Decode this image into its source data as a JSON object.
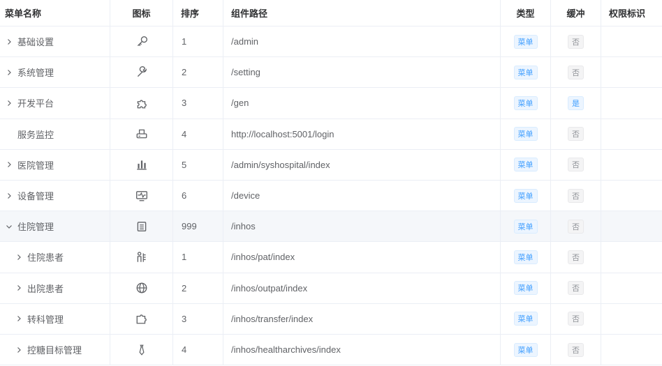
{
  "columns": {
    "name": "菜单名称",
    "icon": "图标",
    "sort": "排序",
    "path": "组件路径",
    "type": "类型",
    "cache": "缓冲",
    "perm": "权限标识"
  },
  "rows": [
    {
      "name": "基础设置",
      "expand": "collapsed",
      "indent": 0,
      "icon": "key-icon",
      "sort": "1",
      "path": "/admin",
      "type": "菜单",
      "cache": "否"
    },
    {
      "name": "系统管理",
      "expand": "collapsed",
      "indent": 0,
      "icon": "wrench-icon",
      "sort": "2",
      "path": "/setting",
      "type": "菜单",
      "cache": "否"
    },
    {
      "name": "开发平台",
      "expand": "collapsed",
      "indent": 0,
      "icon": "puzzle-icon",
      "sort": "3",
      "path": "/gen",
      "type": "菜单",
      "cache": "是"
    },
    {
      "name": "服务监控",
      "expand": "none",
      "indent": 0,
      "icon": "printer-icon",
      "sort": "4",
      "path": "http://localhost:5001/login",
      "type": "菜单",
      "cache": "否"
    },
    {
      "name": "医院管理",
      "expand": "collapsed",
      "indent": 0,
      "icon": "bar-chart-icon",
      "sort": "5",
      "path": "/admin/syshospital/index",
      "type": "菜单",
      "cache": "否"
    },
    {
      "name": "设备管理",
      "expand": "collapsed",
      "indent": 0,
      "icon": "monitor-icon",
      "sort": "6",
      "path": "/device",
      "type": "菜单",
      "cache": "否"
    },
    {
      "name": "住院管理",
      "expand": "expanded",
      "indent": 0,
      "icon": "notebook-icon",
      "sort": "999",
      "path": "/inhos",
      "type": "菜单",
      "cache": "否"
    },
    {
      "name": "住院患者",
      "expand": "collapsed",
      "indent": 1,
      "icon": "patient-icon",
      "sort": "1",
      "path": "/inhos/pat/index",
      "type": "菜单",
      "cache": "否"
    },
    {
      "name": "出院患者",
      "expand": "collapsed",
      "indent": 1,
      "icon": "globe-icon",
      "sort": "2",
      "path": "/inhos/outpat/index",
      "type": "菜单",
      "cache": "否"
    },
    {
      "name": "转科管理",
      "expand": "collapsed",
      "indent": 1,
      "icon": "plugin-icon",
      "sort": "3",
      "path": "/inhos/transfer/index",
      "type": "菜单",
      "cache": "否"
    },
    {
      "name": "控糖目标管理",
      "expand": "collapsed",
      "indent": 1,
      "icon": "tie-icon",
      "sort": "4",
      "path": "/inhos/healtharchives/index",
      "type": "菜单",
      "cache": "否"
    }
  ],
  "colors": {
    "tag_blue": "#409eff",
    "tag_gray": "#909399",
    "border": "#ebeef5",
    "hover": "#f5f7fa"
  }
}
